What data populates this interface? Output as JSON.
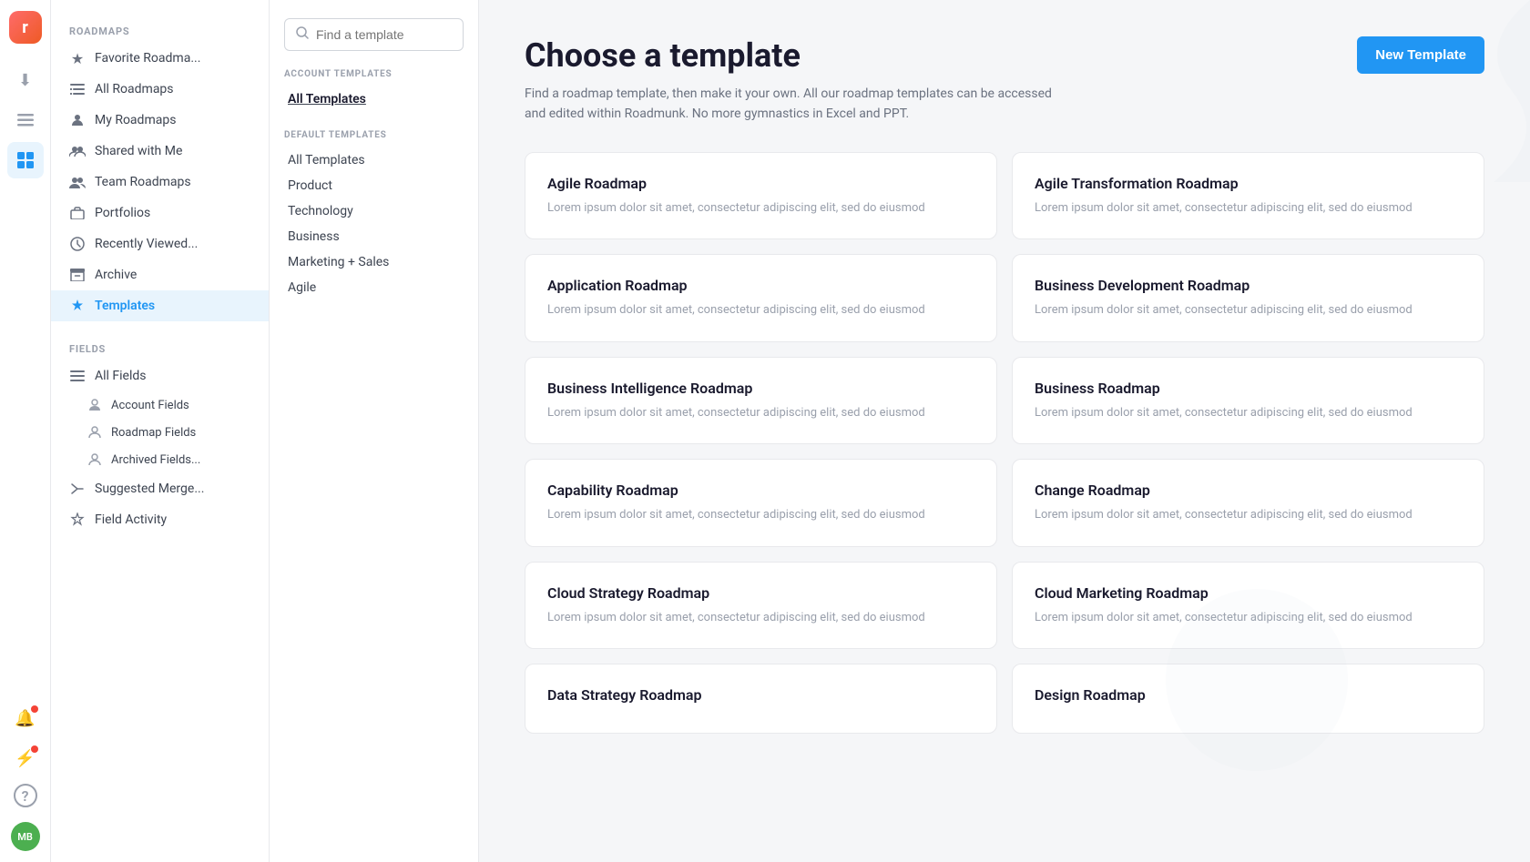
{
  "app": {
    "logo_initials": "R",
    "user_initials": "MB"
  },
  "rail": {
    "icons": [
      {
        "name": "download-icon",
        "symbol": "⬇",
        "active": false,
        "badge": false
      },
      {
        "name": "list-icon",
        "symbol": "☰",
        "active": false,
        "badge": false
      },
      {
        "name": "grid-icon",
        "symbol": "⊞",
        "active": true,
        "badge": false
      },
      {
        "name": "bell-icon",
        "symbol": "🔔",
        "active": false,
        "badge": true
      },
      {
        "name": "lightning-icon",
        "symbol": "⚡",
        "active": false,
        "badge": true
      },
      {
        "name": "help-icon",
        "symbol": "?",
        "active": false,
        "badge": false
      }
    ]
  },
  "sidebar": {
    "roadmaps_label": "ROADMAPS",
    "fields_label": "FIELDS",
    "items": [
      {
        "id": "favorite-roadmaps",
        "label": "Favorite Roadma...",
        "icon": "★",
        "active": false
      },
      {
        "id": "all-roadmaps",
        "label": "All Roadmaps",
        "icon": "≡",
        "active": false
      },
      {
        "id": "my-roadmaps",
        "label": "My Roadmaps",
        "icon": "👤",
        "active": false
      },
      {
        "id": "shared-with-me",
        "label": "Shared with Me",
        "icon": "👥",
        "active": false
      },
      {
        "id": "team-roadmaps",
        "label": "Team Roadmaps",
        "icon": "👥",
        "active": false
      },
      {
        "id": "portfolios",
        "label": "Portfolios",
        "icon": "💼",
        "active": false
      },
      {
        "id": "recently-viewed",
        "label": "Recently Viewed...",
        "icon": "🕐",
        "active": false
      },
      {
        "id": "archive",
        "label": "Archive",
        "icon": "🗄",
        "active": false
      },
      {
        "id": "templates",
        "label": "Templates",
        "icon": "✦",
        "active": true
      }
    ],
    "field_items": [
      {
        "id": "all-fields",
        "label": "All Fields",
        "icon": "≡",
        "active": false
      },
      {
        "id": "account-fields",
        "label": "Account Fields",
        "icon": "👤",
        "sub": true
      },
      {
        "id": "roadmap-fields",
        "label": "Roadmap Fields",
        "icon": "👤",
        "sub": true
      },
      {
        "id": "archived-fields",
        "label": "Archived Fields...",
        "icon": "👤",
        "sub": true
      },
      {
        "id": "suggested-merge",
        "label": "Suggested Merge...",
        "icon": "→",
        "sub": false
      },
      {
        "id": "field-activity",
        "label": "Field Activity",
        "icon": "✦",
        "sub": false
      }
    ]
  },
  "template_panel": {
    "search_placeholder": "Find a template",
    "account_templates_label": "ACCOUNT TEMPLATES",
    "default_templates_label": "DEFAULT TEMPLATES",
    "account_links": [
      {
        "id": "all-templates-acct",
        "label": "All Templates",
        "active": true
      }
    ],
    "default_links": [
      {
        "id": "all-templates-def",
        "label": "All Templates",
        "active": false
      },
      {
        "id": "product",
        "label": "Product",
        "active": false
      },
      {
        "id": "technology",
        "label": "Technology",
        "active": false
      },
      {
        "id": "business",
        "label": "Business",
        "active": false
      },
      {
        "id": "marketing-sales",
        "label": "Marketing + Sales",
        "active": false
      },
      {
        "id": "agile",
        "label": "Agile",
        "active": false
      }
    ]
  },
  "main": {
    "title": "Choose a template",
    "subtitle": "Find a roadmap template, then make it your own. All our roadmap templates can be accessed and edited within Roadmunk. No more gymnastics in Excel and PPT.",
    "new_template_label": "New Template",
    "cards": [
      {
        "id": "agile-roadmap",
        "title": "Agile Roadmap",
        "desc": "Lorem ipsum dolor sit amet, consectetur adipiscing elit, sed do eiusmod"
      },
      {
        "id": "agile-transformation",
        "title": "Agile Transformation Roadmap",
        "desc": "Lorem ipsum dolor sit amet, consectetur adipiscing elit, sed do eiusmod"
      },
      {
        "id": "application-roadmap",
        "title": "Application Roadmap",
        "desc": "Lorem ipsum dolor sit amet, consectetur adipiscing elit, sed do eiusmod"
      },
      {
        "id": "business-development",
        "title": "Business Development Roadmap",
        "desc": "Lorem ipsum dolor sit amet, consectetur adipiscing elit, sed do eiusmod"
      },
      {
        "id": "business-intelligence",
        "title": "Business Intelligence Roadmap",
        "desc": "Lorem ipsum dolor sit amet, consectetur adipiscing elit, sed do eiusmod"
      },
      {
        "id": "business-roadmap",
        "title": "Business Roadmap",
        "desc": "Lorem ipsum dolor sit amet, consectetur adipiscing elit, sed do eiusmod"
      },
      {
        "id": "capability-roadmap",
        "title": "Capability Roadmap",
        "desc": "Lorem ipsum dolor sit amet, consectetur adipiscing elit, sed do eiusmod"
      },
      {
        "id": "change-roadmap",
        "title": "Change Roadmap",
        "desc": "Lorem ipsum dolor sit amet, consectetur adipiscing elit, sed do eiusmod"
      },
      {
        "id": "cloud-strategy",
        "title": "Cloud Strategy Roadmap",
        "desc": "Lorem ipsum dolor sit amet, consectetur adipiscing elit, sed do eiusmod"
      },
      {
        "id": "cloud-marketing",
        "title": "Cloud Marketing Roadmap",
        "desc": "Lorem ipsum dolor sit amet, consectetur adipiscing elit, sed do eiusmod"
      },
      {
        "id": "data-strategy",
        "title": "Data Strategy Roadmap",
        "desc": ""
      },
      {
        "id": "design-roadmap",
        "title": "Design Roadmap",
        "desc": ""
      }
    ]
  }
}
